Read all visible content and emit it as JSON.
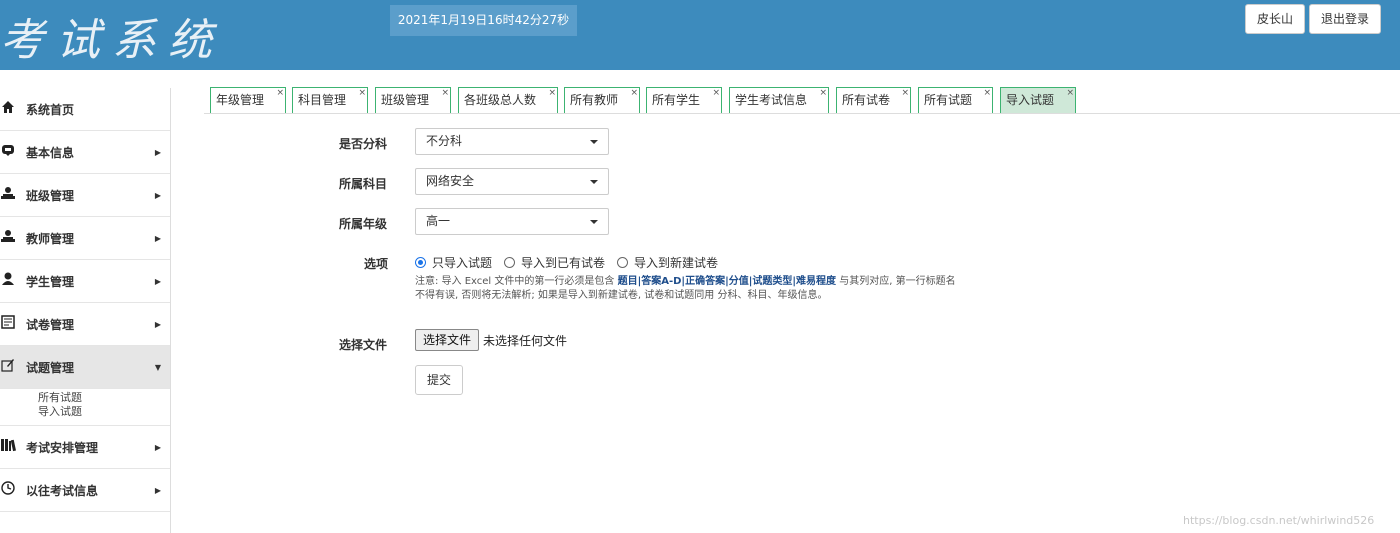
{
  "header": {
    "logo": "考试系统",
    "datetime": "2021年1月19日16时42分27秒",
    "user_button": "皮长山",
    "logout_button": "退出登录"
  },
  "sidebar": {
    "items": [
      {
        "label": "系统首页",
        "icon": "home-icon"
      },
      {
        "label": "基本信息",
        "icon": "info-icon"
      },
      {
        "label": "班级管理",
        "icon": "users-icon"
      },
      {
        "label": "教师管理",
        "icon": "users-icon"
      },
      {
        "label": "学生管理",
        "icon": "user-icon"
      },
      {
        "label": "试卷管理",
        "icon": "list-icon"
      },
      {
        "label": "试题管理",
        "icon": "edit-icon"
      },
      {
        "label": "考试安排管理",
        "icon": "books-icon"
      },
      {
        "label": "以往考试信息",
        "icon": "clock-icon"
      }
    ],
    "submenu": [
      "所有试题",
      "导入试题"
    ]
  },
  "tabs": [
    {
      "label": "年级管理"
    },
    {
      "label": "科目管理"
    },
    {
      "label": "班级管理"
    },
    {
      "label": "各班级总人数"
    },
    {
      "label": "所有教师"
    },
    {
      "label": "所有学生"
    },
    {
      "label": "学生考试信息"
    },
    {
      "label": "所有试卷"
    },
    {
      "label": "所有试题"
    },
    {
      "label": "导入试题"
    }
  ],
  "tab_close": "×",
  "form": {
    "subject_split_label": "是否分科",
    "subject_split_value": "不分科",
    "subject_label": "所属科目",
    "subject_value": "网络安全",
    "grade_label": "所属年级",
    "grade_value": "高一",
    "options_label": "选项",
    "radio_1": "只导入试题",
    "radio_2": "导入到已有试卷",
    "radio_3": "导入到新建试卷",
    "note_prefix": "注意: 导入 Excel 文件中的第一行必须是包含 ",
    "note_fields": "题目|答案A-D|正确答案|分值|试题类型|难易程度",
    "note_suffix": " 与其列对应, 第一行标题名不得有误, 否则将无法解析; 如果是导入到新建试卷, 试卷和试题同用 分科、科目、年级信息。",
    "file_label": "选择文件",
    "file_button": "选择文件",
    "file_status": "未选择任何文件",
    "submit": "提交"
  },
  "watermark": "https://blog.csdn.net/whirlwind526",
  "colors": {
    "header_bg": "#3d8bbd",
    "tab_border": "#3cb371",
    "active_tab_bg": "#cfe8d8"
  }
}
